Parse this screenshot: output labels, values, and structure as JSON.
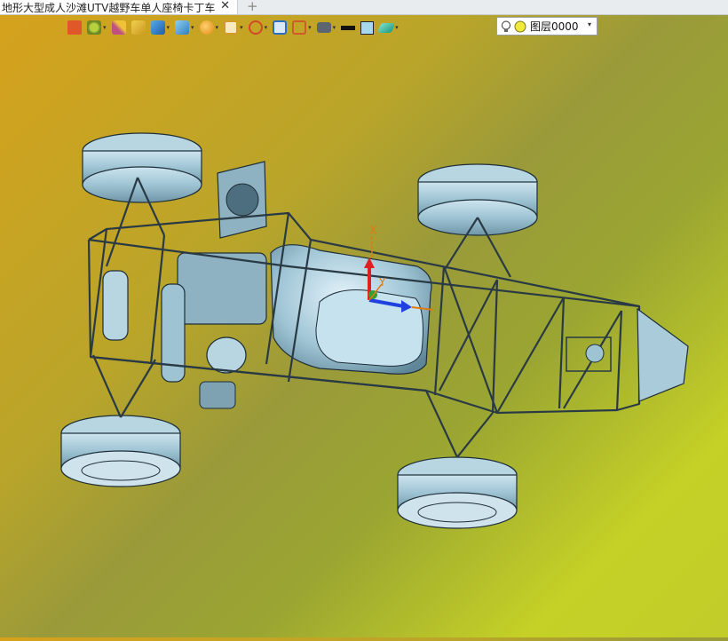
{
  "tab": {
    "title": "地形大型成人沙滩UTV越野车单人座椅卡丁车]",
    "close_glyph": "✕",
    "new_glyph": "+"
  },
  "toolbar": {
    "items": [
      {
        "icon": "exit-icon",
        "color": "#e0582a"
      },
      {
        "icon": "tree-icon",
        "color": "#8aa42a"
      },
      {
        "icon": "brush-icon",
        "color": "#c05080"
      },
      {
        "icon": "box-icon",
        "color": "#e4c23a"
      },
      {
        "icon": "cube-icon",
        "color": "#2f7fd0"
      },
      {
        "icon": "view-cube-icon",
        "color": "#3aa0d8"
      },
      {
        "icon": "sphere-icon",
        "color": "#f2a31c"
      },
      {
        "icon": "zoom-fit-icon",
        "color": "#d29a2a"
      },
      {
        "icon": "orient-icon",
        "color": "#d04a2a"
      },
      {
        "icon": "frame-icon",
        "color": "#2b6fbf"
      },
      {
        "icon": "section-icon",
        "color": "#d05a2a"
      },
      {
        "icon": "display-icon",
        "color": "#5c6570"
      },
      {
        "icon": "line-style-icon",
        "color": "#111111"
      },
      {
        "icon": "fill-color-icon",
        "color": "#a8d8f0"
      },
      {
        "icon": "layers-icon",
        "color": "#3ab8a0"
      }
    ],
    "caret": "▾",
    "layer": {
      "label": "图层0000",
      "bulb_color": "#f2ea38"
    }
  },
  "viewport": {
    "triad": {
      "x_label": "X",
      "y_label": "Y",
      "z_label": "Z"
    },
    "model_color": "#9ec4d4"
  }
}
